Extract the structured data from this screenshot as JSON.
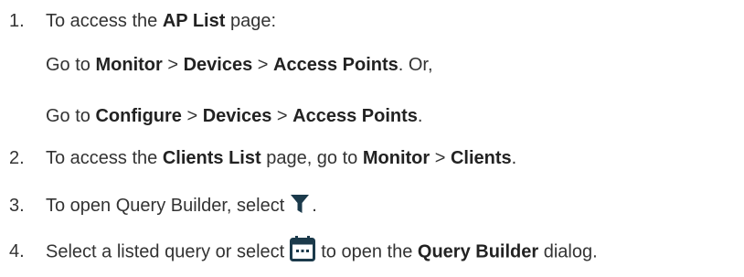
{
  "steps": [
    {
      "number": "1.",
      "intro_prefix": "To access the ",
      "intro_bold": "AP List",
      "intro_suffix": " page:",
      "path1": {
        "prefix": "Go to ",
        "part1": "Monitor",
        "sep1": " > ",
        "part2": "Devices",
        "sep2": " > ",
        "part3": "Access Points",
        "suffix": ". Or,"
      },
      "path2": {
        "prefix": "Go to ",
        "part1": "Configure",
        "sep1": " > ",
        "part2": "Devices",
        "sep2": " > ",
        "part3": "Access Points",
        "suffix": "."
      }
    },
    {
      "number": "2.",
      "prefix": "To access the ",
      "bold1": "Clients List",
      "mid": " page, go to ",
      "bold2": "Monitor",
      "sep": " > ",
      "bold3": "Clients",
      "suffix": "."
    },
    {
      "number": "3.",
      "text": "To open Query Builder, select",
      "icon": "filter-icon",
      "suffix": "."
    },
    {
      "number": "4.",
      "prefix": "Select a listed query or select",
      "icon": "calendar-icon",
      "mid": "to open the ",
      "bold": "Query Builder",
      "suffix": " dialog."
    }
  ],
  "colors": {
    "text": "#333333",
    "icon": "#1b3a4b"
  }
}
